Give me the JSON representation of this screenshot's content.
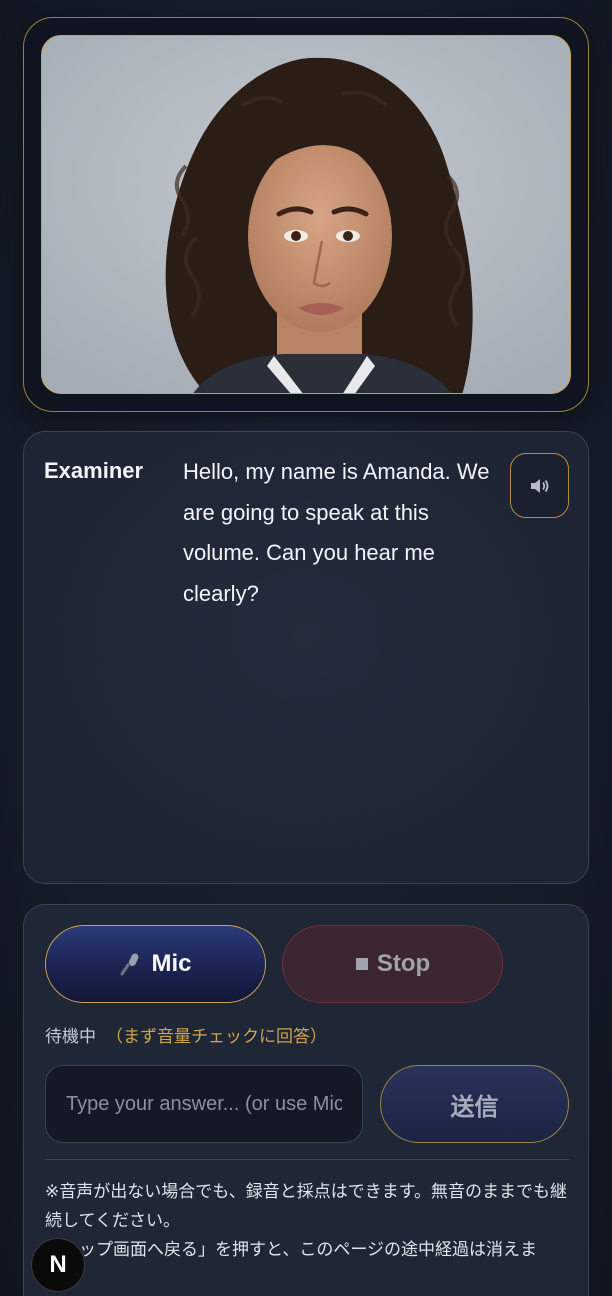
{
  "examiner": {
    "speaker_label": "Examiner",
    "message": "Hello, my name is Amanda. We are going to speak at this volume. Can you hear me clearly?",
    "speak_icon": "speaker-icon"
  },
  "controls": {
    "mic_icon": "microphone-icon",
    "mic_label": "Mic",
    "stop_icon": "stop-square-icon",
    "stop_label": "Stop",
    "status": "待機中",
    "status_note": "（まず音量チェックに回答）",
    "answer_placeholder": "Type your answer... (or use Mic)",
    "send_label": "送信"
  },
  "notes": {
    "line1": "※音声が出ない場合でも、録音と採点はできます。無音のままでも継続してください。",
    "line2": "「トップ画面へ戻る」を押すと、このページの途中経過は消えます。"
  },
  "badge": {
    "label": "N"
  },
  "colors": {
    "accent_gold": "#c9a24e",
    "mic_blue": "#1b2350",
    "stop_red": "#6b3238",
    "status_note": "#cda44c"
  }
}
